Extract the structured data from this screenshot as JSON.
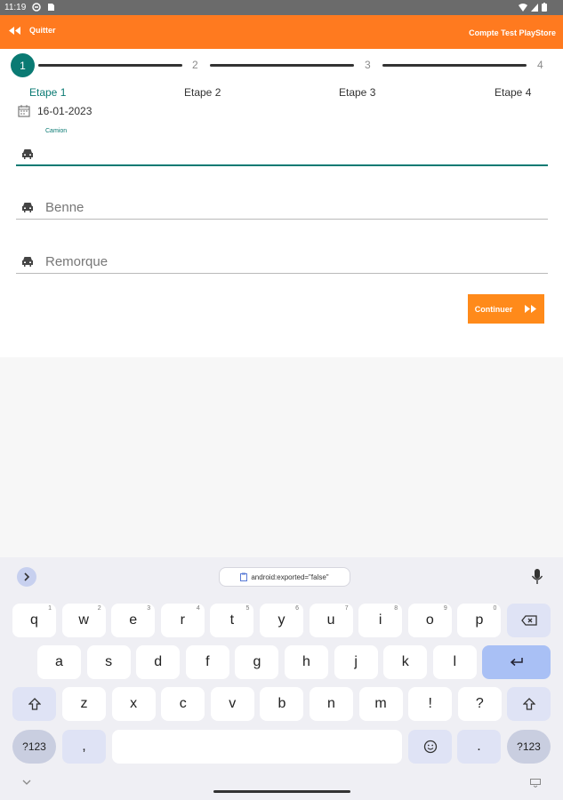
{
  "status_bar": {
    "time": "11:19"
  },
  "app_bar": {
    "back_label": "Quitter",
    "account_label": "Compte Test PlayStore"
  },
  "stepper": {
    "active_step": "1",
    "numbers": [
      "2",
      "3",
      "4"
    ],
    "labels": [
      "Etape 1",
      "Etape 2",
      "Etape 3",
      "Etape 4"
    ]
  },
  "form": {
    "date": "16-01-2023",
    "camion_label": "Camion",
    "benne_label": "Benne",
    "remorque_label": "Remorque",
    "continue_label": "Continuer"
  },
  "keyboard": {
    "clipboard_chip": "android:exported=\"false\"",
    "row1": [
      {
        "k": "q",
        "h": "1"
      },
      {
        "k": "w",
        "h": "2"
      },
      {
        "k": "e",
        "h": "3"
      },
      {
        "k": "r",
        "h": "4"
      },
      {
        "k": "t",
        "h": "5"
      },
      {
        "k": "y",
        "h": "6"
      },
      {
        "k": "u",
        "h": "7"
      },
      {
        "k": "i",
        "h": "8"
      },
      {
        "k": "o",
        "h": "9"
      },
      {
        "k": "p",
        "h": "0"
      }
    ],
    "row2": [
      "a",
      "s",
      "d",
      "f",
      "g",
      "h",
      "j",
      "k",
      "l"
    ],
    "row3": [
      "z",
      "x",
      "c",
      "v",
      "b",
      "n",
      "m",
      "!",
      "?"
    ],
    "symbols_label": "?123",
    "comma": ",",
    "period": "."
  },
  "colors": {
    "accent": "#ff7a1f",
    "teal": "#0a7a73"
  },
  "icons": [
    "double-chevron-left-icon",
    "calendar-icon",
    "car-icon",
    "double-chevron-right-icon",
    "backspace-icon",
    "enter-icon",
    "shift-icon",
    "emoji-icon",
    "mic-icon",
    "clipboard-icon"
  ]
}
